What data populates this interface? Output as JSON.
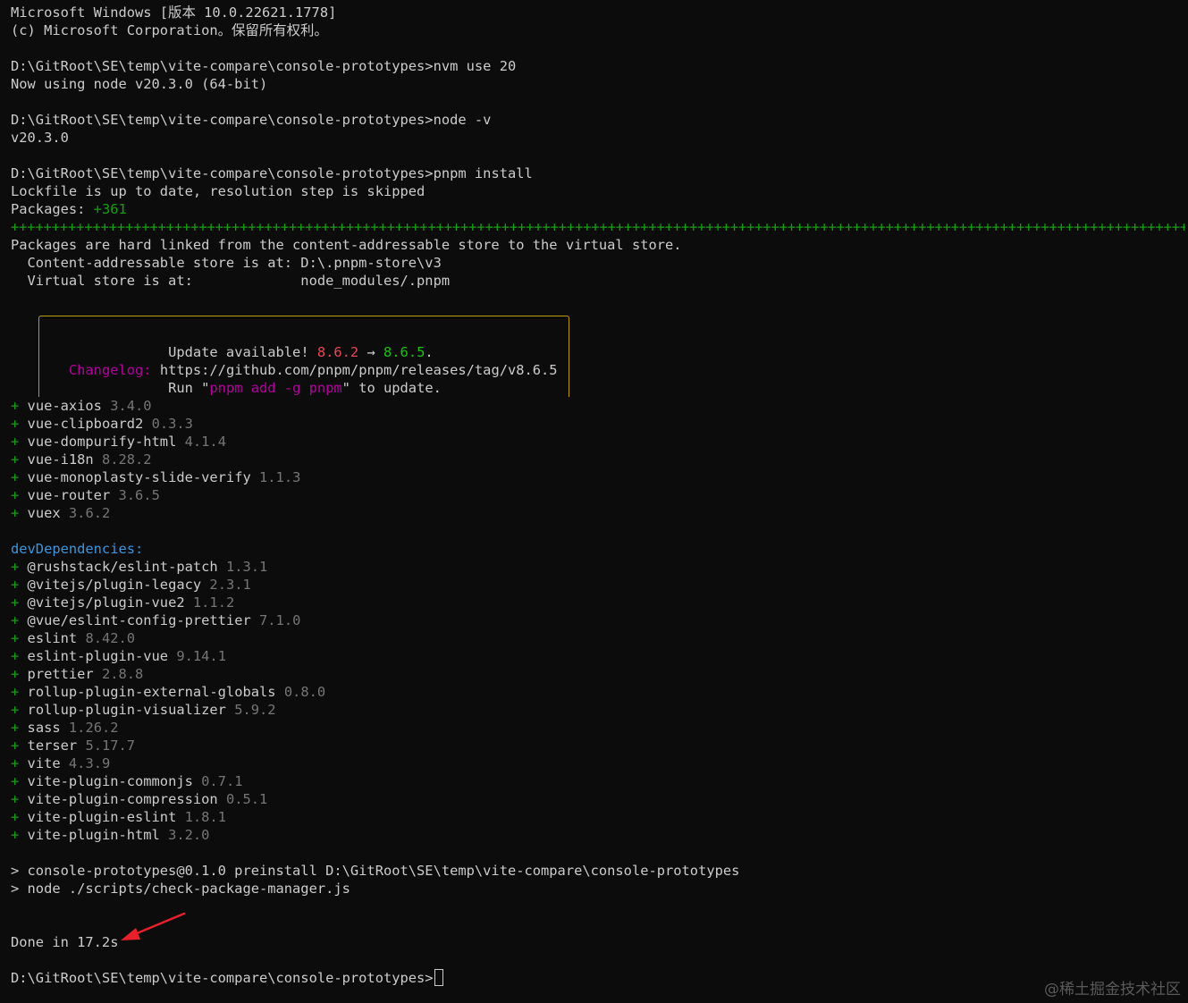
{
  "header": {
    "line1": "Microsoft Windows [版本 10.0.22621.1778]",
    "line2": "(c) Microsoft Corporation。保留所有权利。"
  },
  "commands": [
    {
      "prompt": "D:\\GitRoot\\SE\\temp\\vite-compare\\console-prototypes>",
      "command": "nvm use 20",
      "output": "Now using node v20.3.0 (64-bit)"
    },
    {
      "prompt": "D:\\GitRoot\\SE\\temp\\vite-compare\\console-prototypes>",
      "command": "node -v",
      "output": "v20.3.0"
    },
    {
      "prompt": "D:\\GitRoot\\SE\\temp\\vite-compare\\console-prototypes>",
      "command": "pnpm install",
      "output": "Lockfile is up to date, resolution step is skipped"
    }
  ],
  "packages": {
    "label": "Packages: ",
    "count": "+361",
    "separator": "+++++++++++++++++++++++++++++++++++++++++++++++++++++++++++++++++++++++++++++++++++++++++++++++++++++++++++++++++++++++++++++++++++++++++++++++++++++",
    "linked_line": "Packages are hard linked from the content-addressable store to the virtual store.",
    "store_line": "  Content-addressable store is at: D:\\.pnpm-store\\v3",
    "virtual_line": "  Virtual store is at:             node_modules/.pnpm"
  },
  "update": {
    "text_pre": "Update available! ",
    "old_version": "8.6.2",
    "arrow": " → ",
    "new_version": "8.6.5",
    "period": ".",
    "changelog_label": "Changelog:",
    "changelog_url": " https://github.com/pnpm/pnpm/releases/tag/v8.6.5",
    "run_pre": "Run \"",
    "run_cmd": "pnpm add -g pnpm",
    "run_post": "\" to update."
  },
  "dependencies": [
    {
      "name": "vue-axios",
      "version": "3.4.0"
    },
    {
      "name": "vue-clipboard2",
      "version": "0.3.3"
    },
    {
      "name": "vue-dompurify-html",
      "version": "4.1.4"
    },
    {
      "name": "vue-i18n",
      "version": "8.28.2"
    },
    {
      "name": "vue-monoplasty-slide-verify",
      "version": "1.1.3"
    },
    {
      "name": "vue-router",
      "version": "3.6.5"
    },
    {
      "name": "vuex",
      "version": "3.6.2"
    }
  ],
  "dev_label": "devDependencies:",
  "dev_dependencies": [
    {
      "name": "@rushstack/eslint-patch",
      "version": "1.3.1"
    },
    {
      "name": "@vitejs/plugin-legacy",
      "version": "2.3.1"
    },
    {
      "name": "@vitejs/plugin-vue2",
      "version": "1.1.2"
    },
    {
      "name": "@vue/eslint-config-prettier",
      "version": "7.1.0"
    },
    {
      "name": "eslint",
      "version": "8.42.0"
    },
    {
      "name": "eslint-plugin-vue",
      "version": "9.14.1"
    },
    {
      "name": "prettier",
      "version": "2.8.8"
    },
    {
      "name": "rollup-plugin-external-globals",
      "version": "0.8.0"
    },
    {
      "name": "rollup-plugin-visualizer",
      "version": "5.9.2"
    },
    {
      "name": "sass",
      "version": "1.26.2"
    },
    {
      "name": "terser",
      "version": "5.17.7"
    },
    {
      "name": "vite",
      "version": "4.3.9"
    },
    {
      "name": "vite-plugin-commonjs",
      "version": "0.7.1"
    },
    {
      "name": "vite-plugin-compression",
      "version": "0.5.1"
    },
    {
      "name": "vite-plugin-eslint",
      "version": "1.8.1"
    },
    {
      "name": "vite-plugin-html",
      "version": "3.2.0"
    }
  ],
  "scripts": [
    "> console-prototypes@0.1.0 preinstall D:\\GitRoot\\SE\\temp\\vite-compare\\console-prototypes",
    "> node ./scripts/check-package-manager.js"
  ],
  "done": "Done in 17.2s",
  "final_prompt": "D:\\GitRoot\\SE\\temp\\vite-compare\\console-prototypes>",
  "watermark": "@稀土掘金技术社区",
  "colors": {
    "background": "#0c0c0c",
    "text": "#cccccc",
    "gray": "#767676",
    "green": "#13a10e",
    "blue": "#3a96dd",
    "magenta": "#b4009e",
    "red": "#e74856",
    "yellow": "#c19c00",
    "annotation_arrow": "#e8202a"
  },
  "icons": {
    "annotation": "red-arrow-icon",
    "cursor": "block-cursor-icon"
  }
}
